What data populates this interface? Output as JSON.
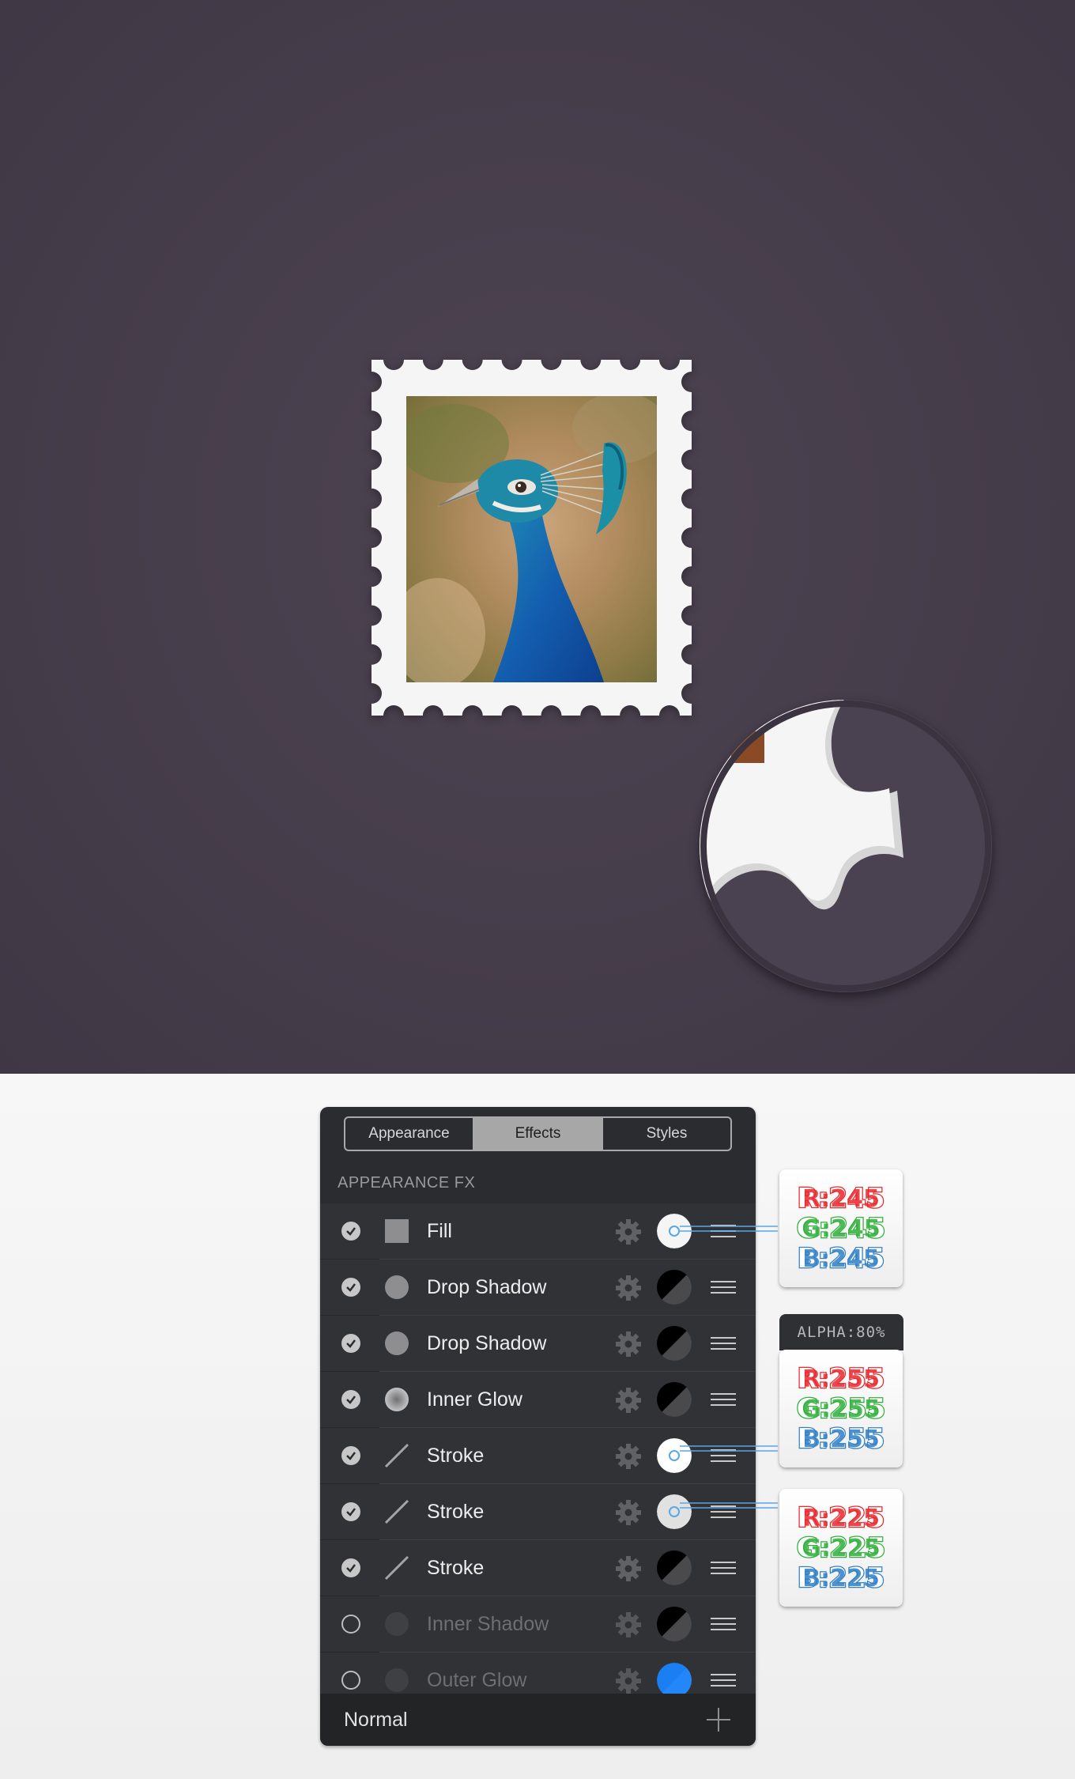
{
  "tabs": [
    {
      "label": "Appearance",
      "active": false
    },
    {
      "label": "Effects",
      "active": true
    },
    {
      "label": "Styles",
      "active": false
    }
  ],
  "section_title": "APPEARANCE FX",
  "effects": [
    {
      "name": "Fill",
      "enabled": true,
      "icon": "square-fill-icon",
      "swatch": "solid-light",
      "color": "#f5f5f5"
    },
    {
      "name": "Drop Shadow",
      "enabled": true,
      "icon": "circle-icon",
      "swatch": "split-dark"
    },
    {
      "name": "Drop Shadow",
      "enabled": true,
      "icon": "circle-icon",
      "swatch": "split-dark"
    },
    {
      "name": "Inner Glow",
      "enabled": true,
      "icon": "glow-circle-icon",
      "swatch": "split-dark"
    },
    {
      "name": "Stroke",
      "enabled": true,
      "icon": "stroke-line-icon",
      "swatch": "solid-light",
      "color": "#ffffff"
    },
    {
      "name": "Stroke",
      "enabled": true,
      "icon": "stroke-line-icon",
      "swatch": "solid-light",
      "color": "#e1e1e1"
    },
    {
      "name": "Stroke",
      "enabled": true,
      "icon": "stroke-line-icon",
      "swatch": "split-dark"
    },
    {
      "name": "Inner Shadow",
      "enabled": false,
      "icon": "circle-icon",
      "swatch": "split-dark"
    },
    {
      "name": "Outer Glow",
      "enabled": false,
      "icon": "circle-icon",
      "swatch": "blue",
      "color": "#1a7ff2"
    }
  ],
  "footer": {
    "blend_mode": "Normal"
  },
  "callouts": [
    {
      "r": "R:245",
      "g": "G:245",
      "b": "B:245"
    },
    {
      "r": "R:255",
      "g": "G:255",
      "b": "B:255",
      "alpha": "ALPHA:80%"
    },
    {
      "r": "R:225",
      "g": "G:225",
      "b": "B:225"
    }
  ],
  "colors": {
    "artboard": "#463d4b",
    "panel": "#313235",
    "callout_red": "#e8262b",
    "callout_green": "#2fae3a",
    "callout_blue": "#2f7fc6",
    "connector": "#5aa6e6"
  }
}
